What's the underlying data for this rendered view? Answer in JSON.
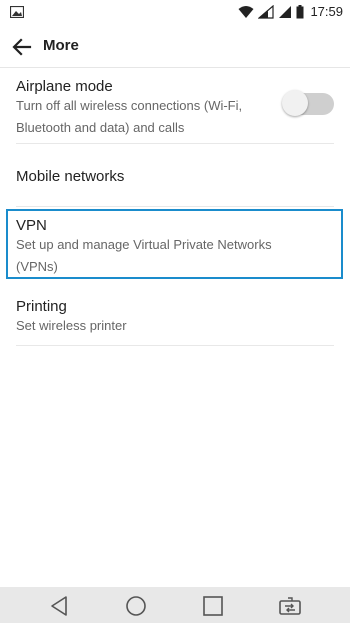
{
  "status_bar": {
    "time": "17:59",
    "icons": [
      "image-notification-icon",
      "wifi-icon",
      "signal-icon",
      "signal-icon",
      "battery-icon"
    ]
  },
  "header": {
    "title": "More",
    "back_icon": "arrow-left-icon"
  },
  "settings": {
    "airplane": {
      "title": "Airplane mode",
      "subtitle": "Turn off all wireless connections (Wi-Fi, Bluetooth and data) and calls",
      "toggle_on": false
    },
    "mobile_networks": {
      "title": "Mobile networks"
    },
    "vpn": {
      "title": "VPN",
      "subtitle": "Set up and manage Virtual Private Networks (VPNs)",
      "highlighted": true
    },
    "printing": {
      "title": "Printing",
      "subtitle": "Set wireless printer"
    }
  },
  "nav_bar": {
    "buttons": [
      "back-icon",
      "home-icon",
      "recents-icon",
      "dual-window-icon"
    ]
  },
  "colors": {
    "highlight_border": "#1a8ccc",
    "nav_bar_bg": "#e8e8e8",
    "toggle_track": "#cfcfcf"
  }
}
